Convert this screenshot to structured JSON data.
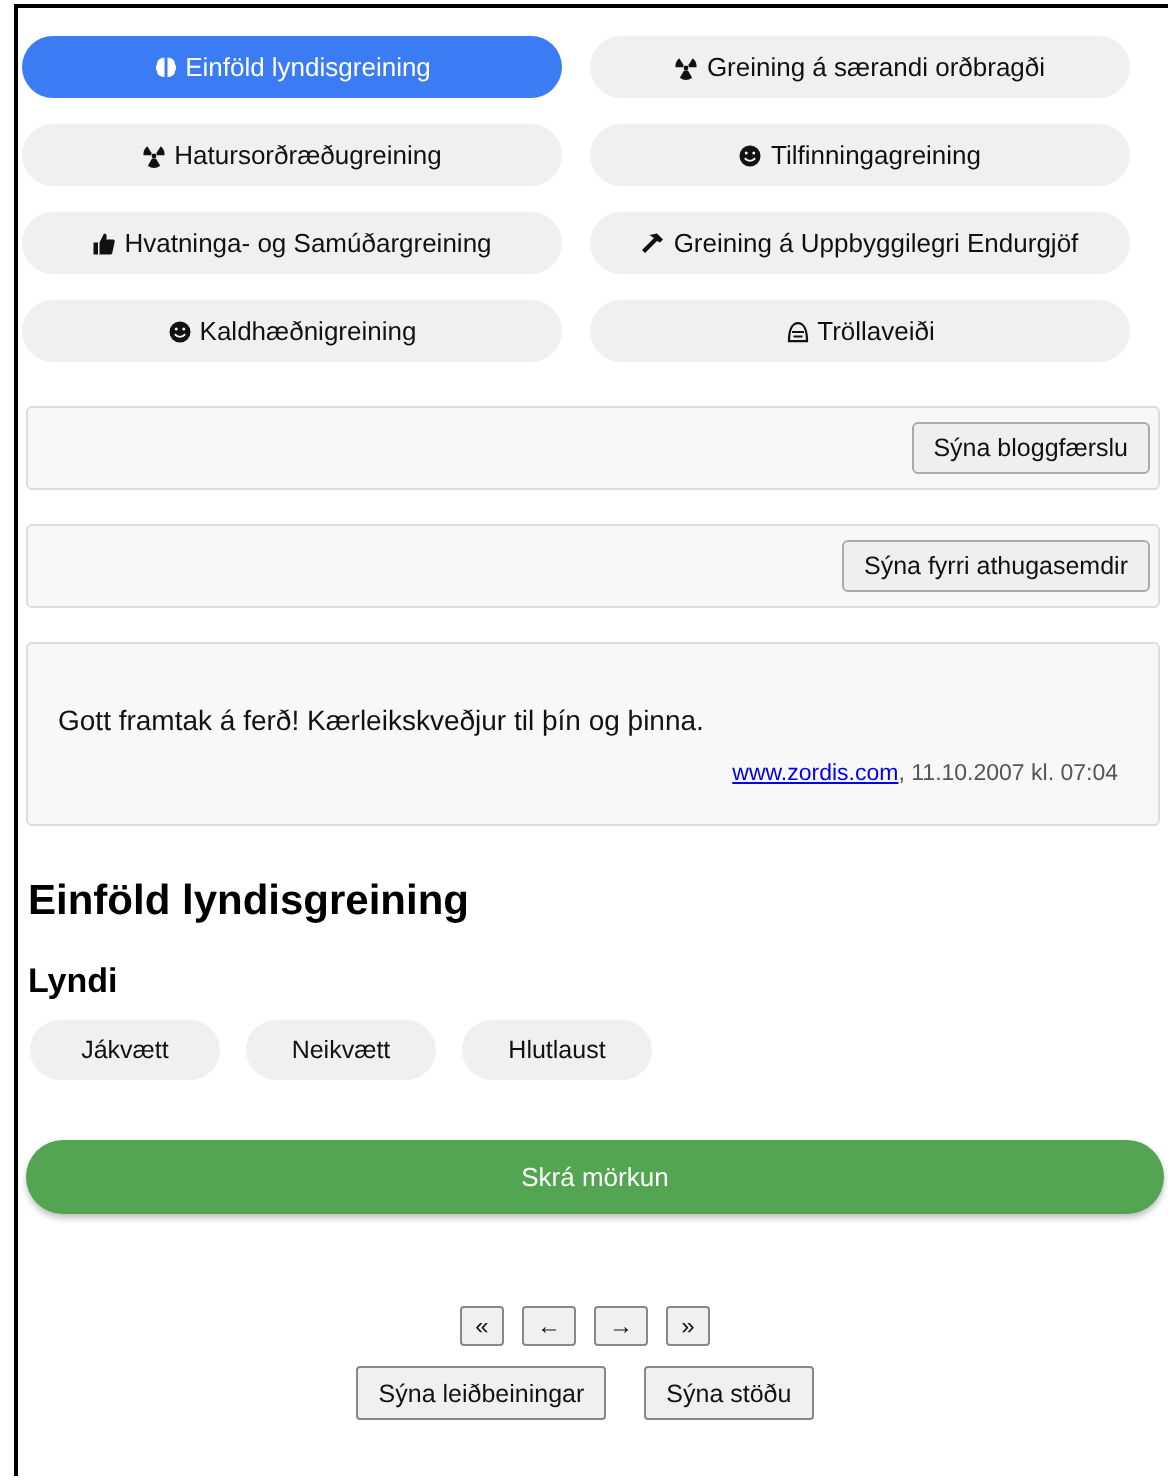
{
  "tabs": [
    {
      "label": "Einföld lyndisgreining",
      "selected": true
    },
    {
      "label": "Greining á særandi orðbragði",
      "selected": false
    },
    {
      "label": "Hatursorðræðugreining",
      "selected": false
    },
    {
      "label": "Tilfinningagreining",
      "selected": false
    },
    {
      "label": "Hvatninga- og Samúðargreining",
      "selected": false
    },
    {
      "label": "Greining á Uppbyggilegri Endurgjöf",
      "selected": false
    },
    {
      "label": "Kaldhæðnigreining",
      "selected": false
    },
    {
      "label": "Tröllaveiði",
      "selected": false
    }
  ],
  "blog_button": "Sýna bloggfærslu",
  "comments_button": "Sýna fyrri athugasemdir",
  "comment": {
    "text": "Gott framtak á ferð!  Kærleikskveðjur til þín og þinna.",
    "author_link": "www.zordis.com",
    "meta": ", 11.10.2007 kl. 07:04"
  },
  "heading": "Einföld lyndisgreining",
  "subheading": "Lyndi",
  "moods": [
    {
      "label": "Jákvætt",
      "selected": false
    },
    {
      "label": "Neikvætt",
      "selected": false
    },
    {
      "label": "Hlutlaust",
      "selected": false
    }
  ],
  "submit_button": "Skrá mörkun",
  "nav_buttons": [
    "«",
    "←",
    "→",
    "»"
  ],
  "footer_buttons": [
    "Sýna leiðbeiningar",
    "Sýna stöðu"
  ]
}
